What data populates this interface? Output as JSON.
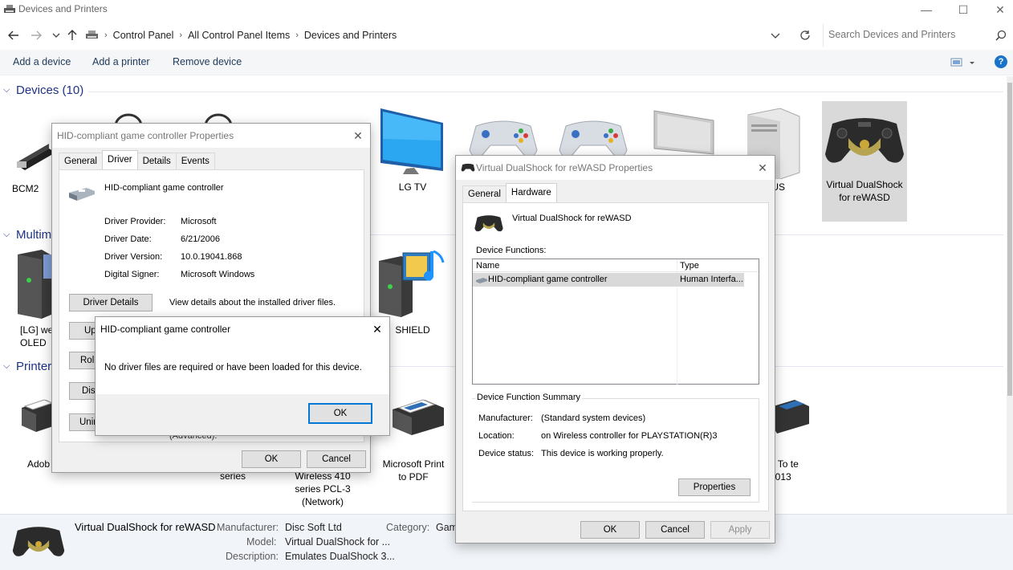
{
  "window": {
    "title": "Devices and Printers",
    "minimize": "—",
    "maximize": "☐",
    "close": "✕"
  },
  "address": {
    "crumbs": [
      "Control Panel",
      "All Control Panel Items",
      "Devices and Printers"
    ],
    "search_placeholder": "Search Devices and Printers"
  },
  "commands": {
    "add_device": "Add a device",
    "add_printer": "Add a printer",
    "remove_device": "Remove device"
  },
  "groups": {
    "devices": "Devices (10)",
    "multimedia": "Multim",
    "printers": "Printers"
  },
  "devices": [
    {
      "label": "BCM2"
    },
    {
      "label": "LG TV"
    },
    {
      "label": "US"
    },
    {
      "label": "Virtual DualShock for reWASD"
    }
  ],
  "multimedia": [
    {
      "label": "[LG] we OLED"
    },
    {
      "label": "SHIELD"
    }
  ],
  "printers": [
    {
      "label": "Adob"
    },
    {
      "label": "series"
    },
    {
      "label": "Wireless 410 series PCL-3 (Network)"
    },
    {
      "label": "Microsoft Print to PDF"
    },
    {
      "label": "d To te 2013"
    }
  ],
  "details_pane": {
    "name": "Virtual DualShock for reWASD",
    "manufacturer_label": "Manufacturer:",
    "manufacturer": "Disc Soft Ltd",
    "model_label": "Model:",
    "model": "Virtual DualShock for ...",
    "description_label": "Description:",
    "description": "Emulates DualShock 3...",
    "category_label": "Category:",
    "category": "Gam"
  },
  "hid_dialog": {
    "title": "HID-compliant game controller Properties",
    "tabs": [
      "General",
      "Driver",
      "Details",
      "Events"
    ],
    "device_name": "HID-compliant game controller",
    "provider_label": "Driver Provider:",
    "provider": "Microsoft",
    "date_label": "Driver Date:",
    "date": "6/21/2006",
    "version_label": "Driver Version:",
    "version": "10.0.19041.868",
    "signer_label": "Digital Signer:",
    "signer": "Microsoft Windows",
    "driver_details_btn": "Driver Details",
    "driver_details_desc": "View details about the installed driver files.",
    "update_btn": "Up",
    "roll_btn": "Roll",
    "disable_btn": "Dis",
    "uninstall_btn": "Unin",
    "advanced_text": "(Advanced).",
    "ok": "OK",
    "cancel": "Cancel"
  },
  "msg_dialog": {
    "title": "HID-compliant game controller",
    "message": "No driver files are required or have been loaded for this device.",
    "ok": "OK"
  },
  "vds_dialog": {
    "title": "Virtual DualShock for reWASD Properties",
    "tabs": [
      "General",
      "Hardware"
    ],
    "device_name": "Virtual DualShock for reWASD",
    "functions_label": "Device Functions:",
    "col_name": "Name",
    "col_type": "Type",
    "rows": [
      {
        "name": "HID-compliant game controller",
        "type": "Human Interfa..."
      }
    ],
    "summary_label": "Device Function Summary",
    "manufacturer_label": "Manufacturer:",
    "manufacturer": "(Standard system devices)",
    "location_label": "Location:",
    "location": "on Wireless controller for PLAYSTATION(R)3",
    "status_label": "Device status:",
    "status": "This device is working properly.",
    "properties_btn": "Properties",
    "ok": "OK",
    "cancel": "Cancel",
    "apply": "Apply"
  },
  "colors": {
    "link_blue": "#1e3287",
    "accent": "#0078d7",
    "help": "#1a73c9"
  },
  "icons": [
    "back-arrow-icon",
    "forward-arrow-icon",
    "up-arrow-icon",
    "refresh-icon",
    "search-icon",
    "help-icon",
    "view-options-icon",
    "controller-icon",
    "monitor-icon",
    "printer-icon",
    "media-player-icon"
  ]
}
